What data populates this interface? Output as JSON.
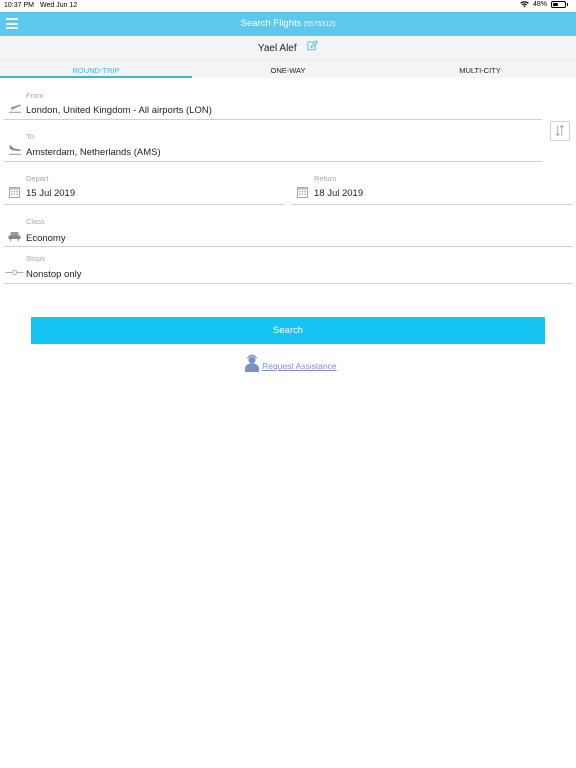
{
  "status_bar": {
    "time": "10:37 PM",
    "date": "Wed Jun 12",
    "battery_percent_label": "48%",
    "battery_level": 0.48
  },
  "header": {
    "title": "Search Flights",
    "number": "(5575312)",
    "menu_icon": "hamburger-menu-icon"
  },
  "traveler": {
    "name": "Yael Alef",
    "edit_icon": "pencil-edit-icon"
  },
  "tabs": [
    {
      "label": "ROUND-TRIP",
      "active": true
    },
    {
      "label": "ONE-WAY",
      "active": false
    },
    {
      "label": "MULTI-CITY",
      "active": false
    }
  ],
  "form": {
    "from": {
      "label": "From",
      "value": "London, United Kingdom - All airports (LON)",
      "icon": "plane-takeoff-icon"
    },
    "to": {
      "label": "To",
      "value": "Amsterdam, Netherlands (AMS)",
      "icon": "plane-landing-icon"
    },
    "swap_icon": "swap-arrows-icon",
    "depart": {
      "label": "Depart",
      "value": "15 Jul 2019",
      "icon": "calendar-icon"
    },
    "return": {
      "label": "Return",
      "value": "18 Jul 2019",
      "icon": "calendar-icon"
    },
    "class": {
      "label": "Class",
      "value": "Economy",
      "icon": "seat-icon"
    },
    "stops": {
      "label": "Stops",
      "value": "Nonstop only",
      "icon": "stops-route-icon"
    }
  },
  "search_button": {
    "label": "Search"
  },
  "assistance": {
    "label": "Request Assistance",
    "icon": "agent-person-icon"
  },
  "colors": {
    "header_bg": "#5ec8ec",
    "accent": "#35b7e2",
    "search_button_bg": "#15c4f2",
    "link": "#7b8fc9"
  }
}
